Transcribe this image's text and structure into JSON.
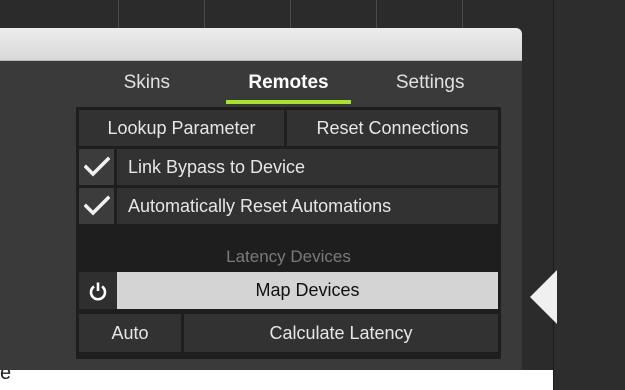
{
  "tabs": [
    {
      "label": "Skins",
      "active": false
    },
    {
      "label": "Remotes",
      "active": true
    },
    {
      "label": "Settings",
      "active": false
    }
  ],
  "buttons": {
    "lookup_parameter": "Lookup Parameter",
    "reset_connections": "Reset Connections",
    "map_devices": "Map Devices",
    "auto": "Auto",
    "calculate_latency": "Calculate Latency"
  },
  "checkboxes": [
    {
      "label": "Link Bypass to Device",
      "checked": true
    },
    {
      "label": "Automatically Reset Automations",
      "checked": true
    }
  ],
  "section": {
    "latency_devices": "Latency Devices"
  },
  "edge_text": "e",
  "colors": {
    "accent": "#a6e22e",
    "panel": "#3a3a3a",
    "titlebar": "#e2e2e2"
  },
  "icons": {
    "check": "check-icon",
    "power": "power-icon",
    "collapse": "triangle-left-icon"
  }
}
